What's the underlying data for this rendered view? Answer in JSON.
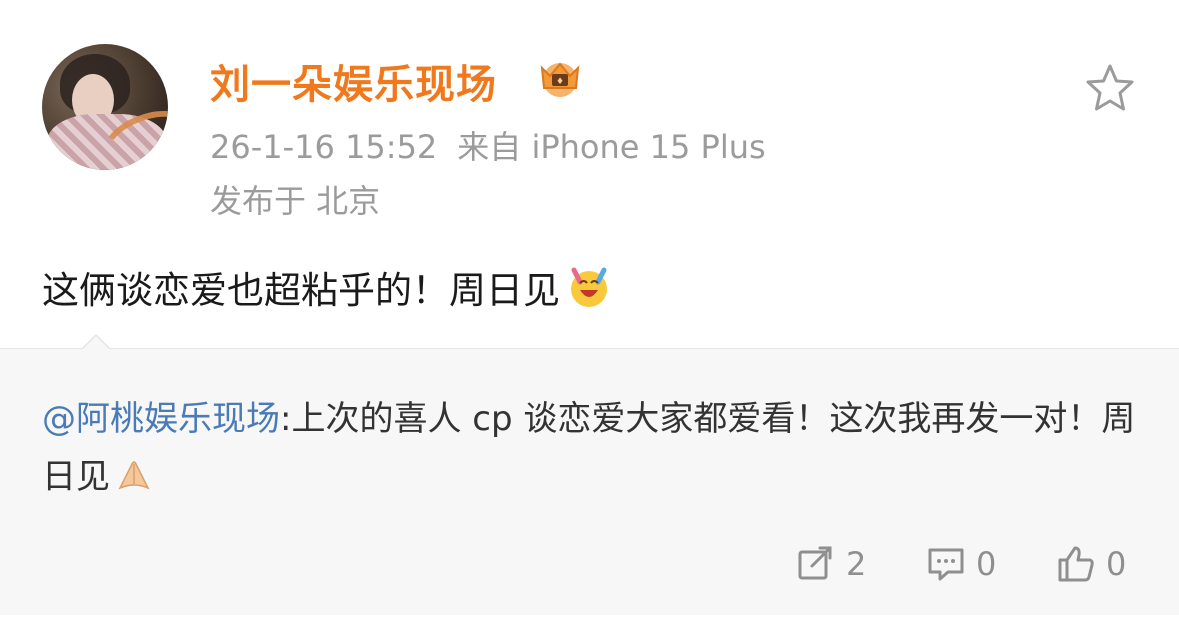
{
  "post": {
    "username": "刘一朵娱乐现场",
    "timestamp": "26-1-16 15:52",
    "source": "来自 iPhone 15 Plus",
    "location": "发布于 北京",
    "text": "这俩谈恋爱也超粘乎的！周日见",
    "icons": {
      "avatar": "avatar-photo",
      "badge": "crown-badge-icon",
      "favorite": "star-icon",
      "emoji": "laughing-tears-emoji-icon"
    }
  },
  "repost": {
    "mention": "@阿桃娱乐现场",
    "text": ":上次的喜人 cp 谈恋爱大家都爱看！这次我再发一对！周日见",
    "emoji": "pleading-hands-emoji-icon"
  },
  "actions": {
    "repost_count": "2",
    "comment_count": "0",
    "like_count": "0"
  },
  "colors": {
    "username": "#f0791e",
    "mention": "#4a7bb7",
    "meta": "#9b9b9b",
    "repost_bg": "#f7f7f7"
  }
}
